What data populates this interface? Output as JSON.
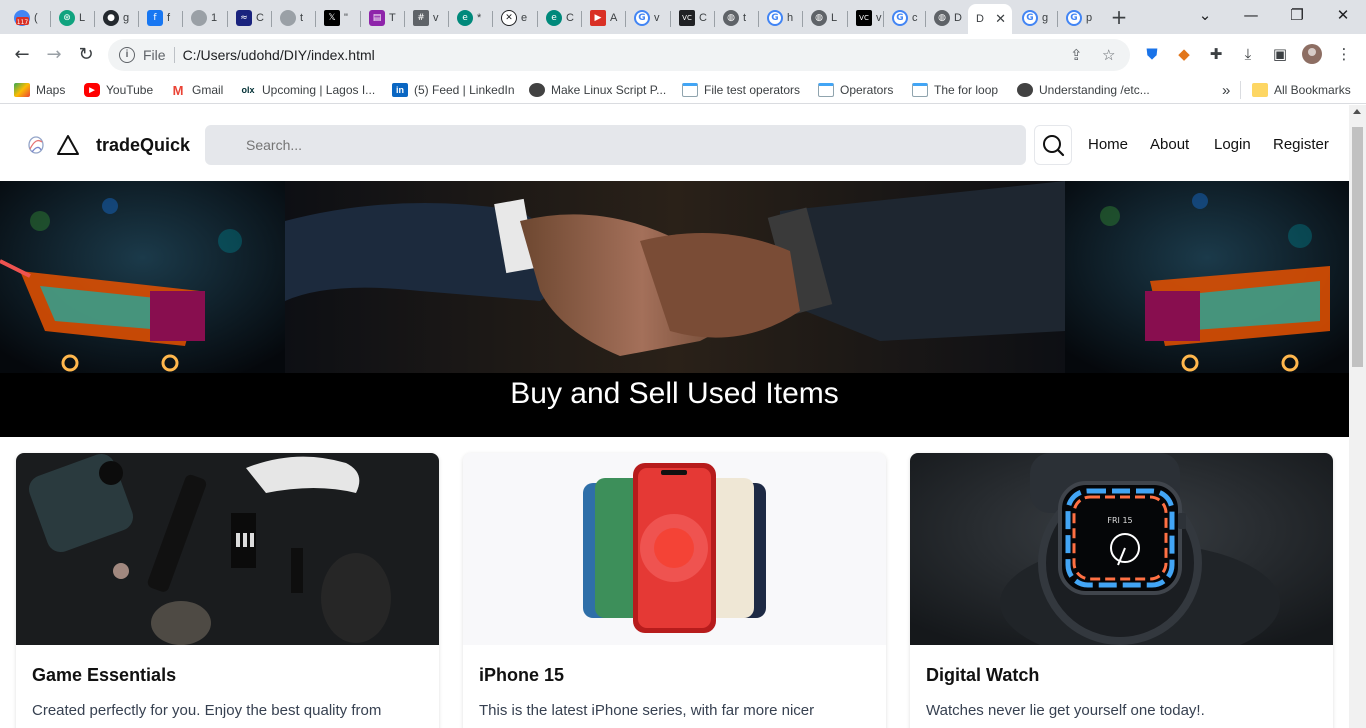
{
  "browser": {
    "tabs": [
      {
        "label": "(",
        "badge": "117",
        "color": "#4285f4"
      },
      {
        "label": "L",
        "color": "#10a37f"
      },
      {
        "label": "g",
        "color": "#24292f"
      },
      {
        "label": "f",
        "color": "#1877f2"
      },
      {
        "label": "1",
        "color": "#9aa0a6"
      },
      {
        "label": "C",
        "color": "#1a237e"
      },
      {
        "label": "t",
        "color": "#9aa0a6"
      },
      {
        "label": "\"",
        "color": "#000000"
      },
      {
        "label": "T",
        "color": "#8e24aa"
      },
      {
        "label": "v",
        "color": "#5f6368"
      },
      {
        "label": "*",
        "color": "#00897b"
      },
      {
        "label": "e",
        "color": "#202124"
      },
      {
        "label": "C",
        "color": "#00897b"
      },
      {
        "label": "A",
        "color": "#d93025"
      },
      {
        "label": "v",
        "color": "#4285f4"
      },
      {
        "label": "C",
        "color": "#202124"
      },
      {
        "label": "t",
        "color": "#5f6368"
      },
      {
        "label": "h",
        "color": "#4285f4"
      },
      {
        "label": "L",
        "color": "#5f6368"
      },
      {
        "label": "v",
        "color": "#000000"
      },
      {
        "label": "c",
        "color": "#4285f4"
      },
      {
        "label": "D",
        "color": "#5f6368"
      },
      {
        "label": "D",
        "color": "#5f6368",
        "active": true
      },
      {
        "label": "g",
        "color": "#4285f4"
      },
      {
        "label": "p",
        "color": "#4285f4"
      }
    ],
    "url_scheme": "File",
    "url": "C:/Users/udohd/DIY/index.html",
    "bookmarks": [
      {
        "label": "Maps",
        "color": "#34a853"
      },
      {
        "label": "YouTube",
        "color": "#ff0000"
      },
      {
        "label": "Gmail",
        "color": "#ea4335"
      },
      {
        "label": "Upcoming | Lagos I...",
        "color": "#5e35b1",
        "icon_text": "olx"
      },
      {
        "label": "(5) Feed | LinkedIn",
        "color": "#0a66c2",
        "icon_text": "in"
      },
      {
        "label": "Make Linux Script P...",
        "color": "#424242"
      },
      {
        "label": "File test operators",
        "color": "#42a5f5"
      },
      {
        "label": "Operators",
        "color": "#42a5f5"
      },
      {
        "label": "The for loop",
        "color": "#42a5f5"
      },
      {
        "label": "Understanding /etc...",
        "color": "#424242"
      }
    ],
    "more_bookmarks": "»",
    "all_bookmarks": "All Bookmarks"
  },
  "site": {
    "brand": "tradeQuick",
    "search_placeholder": "Search...",
    "nav": [
      "Home",
      "About",
      "Login",
      "Register"
    ],
    "hero_title": "Buy and Sell Used Items",
    "cards": [
      {
        "title": "Game Essentials",
        "description": "Created perfectly for you. Enjoy the best quality from"
      },
      {
        "title": "iPhone 15",
        "description": "This is the latest iPhone series, with far more nicer"
      },
      {
        "title": "Digital Watch",
        "description": "Watches never lie get yourself one today!."
      }
    ]
  }
}
